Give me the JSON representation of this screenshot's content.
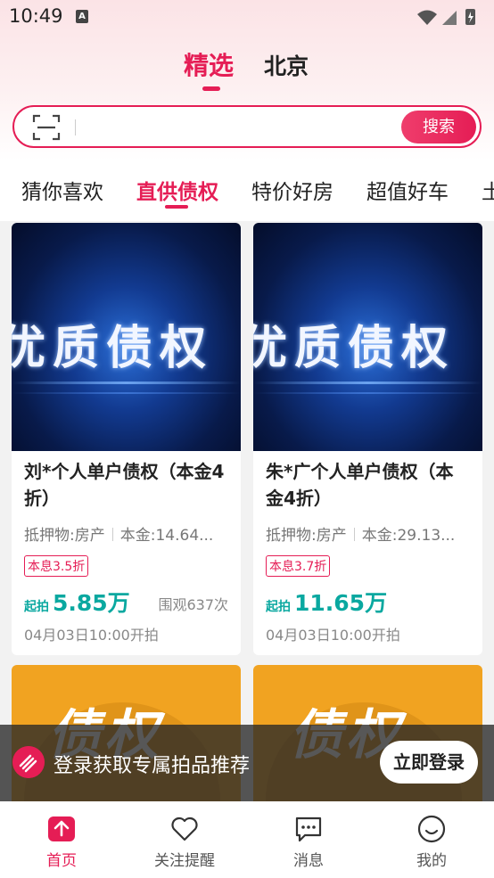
{
  "status_bar": {
    "time": "10:49",
    "notif_letter": "A"
  },
  "location_tabs": {
    "active": "精选",
    "other": "北京"
  },
  "search": {
    "button_label": "搜索"
  },
  "categories": [
    "猜你喜欢",
    "直供债权",
    "特价好房",
    "超值好车",
    "土"
  ],
  "cards": [
    {
      "image_text": "优质债权",
      "title": "刘*个人单户债权（本金4折）",
      "collateral": "抵押物:房产",
      "principal": "本金:14.64...",
      "tag": "本息3.5折",
      "price_label": "起拍",
      "price": "5.85万",
      "views": "围观637次",
      "time": "04月03日10:00开拍"
    },
    {
      "image_text": "优质债权",
      "title": "朱*广个人单户债权（本金4折）",
      "collateral": "抵押物:房产",
      "principal": "本金:29.13...",
      "tag": "本息3.7折",
      "price_label": "起拍",
      "price": "11.65万",
      "views": "",
      "time": "04月03日10:00开拍"
    }
  ],
  "promo_cards": [
    {
      "image_text": "债权"
    },
    {
      "image_text": "债权"
    }
  ],
  "login_banner": {
    "text": "登录获取专属拍品推荐",
    "button": "立即登录"
  },
  "bottom_nav": [
    {
      "label": "首页",
      "icon": "home-icon"
    },
    {
      "label": "关注提醒",
      "icon": "heart-icon"
    },
    {
      "label": "消息",
      "icon": "message-icon"
    },
    {
      "label": "我的",
      "icon": "smile-icon"
    }
  ],
  "colors": {
    "accent": "#e51d55",
    "price": "#0aa8a0"
  }
}
